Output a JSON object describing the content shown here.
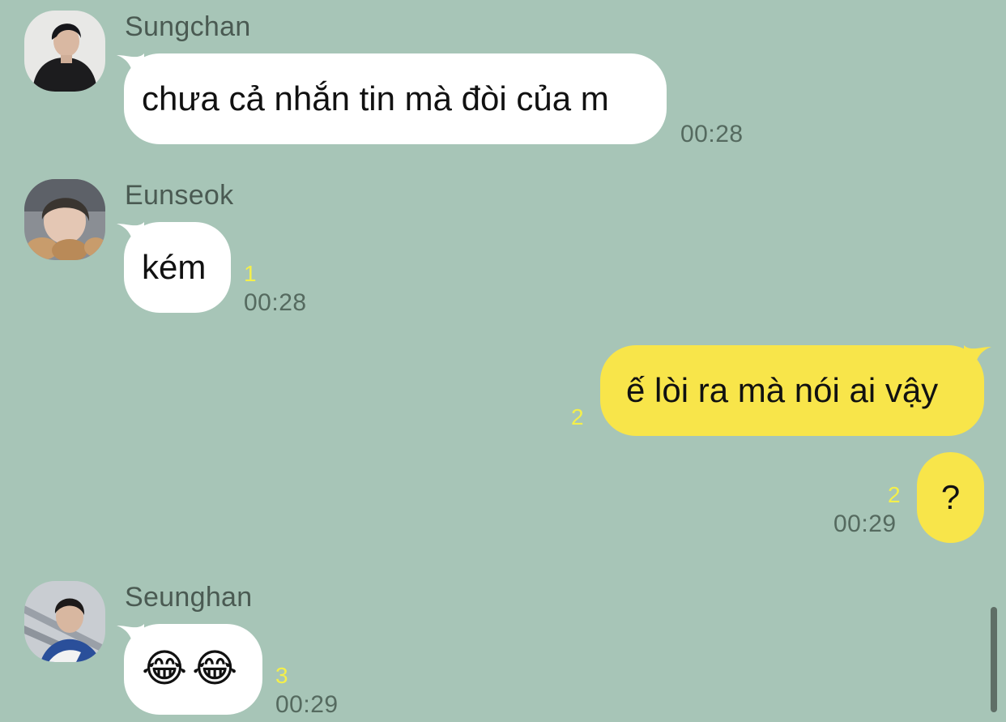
{
  "messages": [
    {
      "sender": "Sungchan",
      "avatar_icon": "profile-photo-sungchan",
      "text": "chưa cả nhắn tin mà đòi của m",
      "time": "00:28",
      "unread": ""
    },
    {
      "sender": "Eunseok",
      "avatar_icon": "profile-photo-eunseok",
      "text": "kém",
      "time": "00:28",
      "unread": "1"
    },
    {
      "sender": "",
      "text": "ế lòi ra mà nói ai vậy",
      "time": "",
      "unread": "2"
    },
    {
      "sender": "",
      "text": "?",
      "time": "00:29",
      "unread": "2"
    },
    {
      "sender": "Seunghan",
      "avatar_icon": "profile-photo-seunghan",
      "text": "😂😂",
      "time": "00:29",
      "unread": "3"
    }
  ],
  "colors": {
    "background": "#a7c5b7",
    "incoming_bubble": "#ffffff",
    "outgoing_bubble": "#f8e54a",
    "unread_count": "#f4ef4a",
    "sender_name": "#4a5a52",
    "timestamp": "#556a5f"
  }
}
